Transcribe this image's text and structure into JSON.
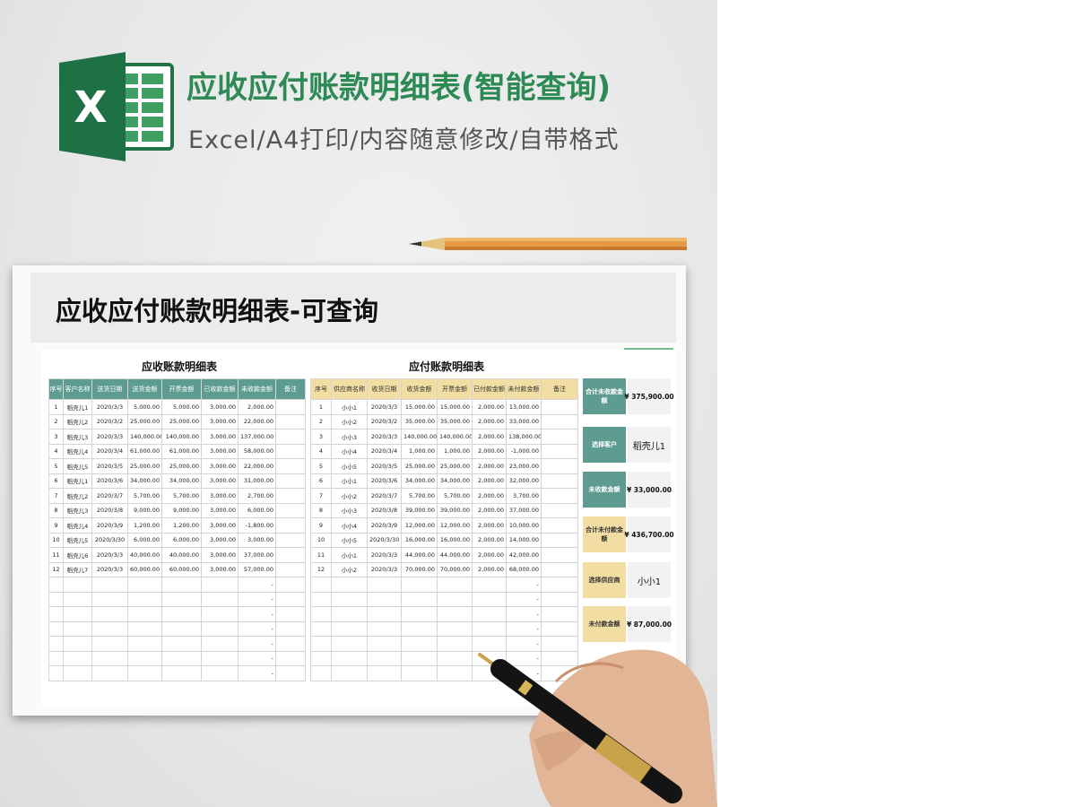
{
  "banner": {
    "logo_letter": "X",
    "title": "应收应付账款明细表(智能查询)",
    "subtitle": "Excel/A4打印/内容随意修改/自带格式",
    "colors": {
      "green": "#2e8a55",
      "subtitle": "#555555"
    },
    "icons": [
      "excel-logo-icon",
      "pencil-icon",
      "hand-with-pen-icon"
    ]
  },
  "sheet": {
    "title": "应收应付账款明细表-可查询",
    "receivable": {
      "title": "应收账款明细表",
      "header_color": "#5e9c91",
      "columns": [
        "序号",
        "客户名称",
        "送货日期",
        "送货金额",
        "开票金额",
        "已收款金额",
        "未收款金额",
        "备注"
      ],
      "rows": [
        [
          "1",
          "稻壳儿1",
          "2020/3/3",
          "5,000.00",
          "5,000.00",
          "3,000.00",
          "2,000.00",
          ""
        ],
        [
          "2",
          "稻壳儿2",
          "2020/3/2",
          "25,000.00",
          "25,000.00",
          "3,000.00",
          "22,000.00",
          ""
        ],
        [
          "3",
          "稻壳儿3",
          "2020/3/3",
          "140,000.00",
          "140,000.00",
          "3,000.00",
          "137,000.00",
          ""
        ],
        [
          "4",
          "稻壳儿4",
          "2020/3/4",
          "61,000.00",
          "61,000.00",
          "3,000.00",
          "58,000.00",
          ""
        ],
        [
          "5",
          "稻壳儿5",
          "2020/3/5",
          "25,000.00",
          "25,000.00",
          "3,000.00",
          "22,000.00",
          ""
        ],
        [
          "6",
          "稻壳儿1",
          "2020/3/6",
          "34,000.00",
          "34,000.00",
          "3,000.00",
          "31,000.00",
          ""
        ],
        [
          "7",
          "稻壳儿2",
          "2020/3/7",
          "5,700.00",
          "5,700.00",
          "3,000.00",
          "2,700.00",
          ""
        ],
        [
          "8",
          "稻壳儿3",
          "2020/3/8",
          "9,000.00",
          "9,000.00",
          "3,000.00",
          "6,000.00",
          ""
        ],
        [
          "9",
          "稻壳儿4",
          "2020/3/9",
          "1,200.00",
          "1,200.00",
          "3,000.00",
          "-1,800.00",
          ""
        ],
        [
          "10",
          "稻壳儿5",
          "2020/3/30",
          "6,000.00",
          "6,000.00",
          "3,000.00",
          "3,000.00",
          ""
        ],
        [
          "11",
          "稻壳儿6",
          "2020/3/3",
          "40,000.00",
          "40,000.00",
          "3,000.00",
          "37,000.00",
          ""
        ],
        [
          "12",
          "稻壳儿7",
          "2020/3/3",
          "60,000.00",
          "60,000.00",
          "3,000.00",
          "57,000.00",
          ""
        ],
        [
          "",
          "",
          "",
          "",
          "",
          "",
          "-",
          ""
        ],
        [
          "",
          "",
          "",
          "",
          "",
          "",
          "-",
          ""
        ],
        [
          "",
          "",
          "",
          "",
          "",
          "",
          "-",
          ""
        ],
        [
          "",
          "",
          "",
          "",
          "",
          "",
          "-",
          ""
        ],
        [
          "",
          "",
          "",
          "",
          "",
          "",
          "-",
          ""
        ],
        [
          "",
          "",
          "",
          "",
          "",
          "",
          "-",
          ""
        ],
        [
          "",
          "",
          "",
          "",
          "",
          "",
          "-",
          ""
        ]
      ]
    },
    "payable": {
      "title": "应付账款明细表",
      "header_color": "#f2dea2",
      "columns": [
        "序号",
        "供应商名称",
        "收货日期",
        "收货金额",
        "开票金额",
        "已付款金额",
        "未付款金额",
        "备注"
      ],
      "rows": [
        [
          "1",
          "小小1",
          "2020/3/3",
          "15,000.00",
          "15,000.00",
          "2,000.00",
          "13,000.00",
          ""
        ],
        [
          "2",
          "小小2",
          "2020/3/2",
          "35,000.00",
          "35,000.00",
          "2,000.00",
          "33,000.00",
          ""
        ],
        [
          "3",
          "小小3",
          "2020/3/3",
          "140,000.00",
          "140,000.00",
          "2,000.00",
          "138,000.00",
          ""
        ],
        [
          "4",
          "小小4",
          "2020/3/4",
          "1,000.00",
          "1,000.00",
          "2,000.00",
          "-1,000.00",
          ""
        ],
        [
          "5",
          "小小5",
          "2020/3/5",
          "25,000.00",
          "25,000.00",
          "2,000.00",
          "23,000.00",
          ""
        ],
        [
          "6",
          "小小1",
          "2020/3/6",
          "34,000.00",
          "34,000.00",
          "2,000.00",
          "32,000.00",
          ""
        ],
        [
          "7",
          "小小2",
          "2020/3/7",
          "5,700.00",
          "5,700.00",
          "2,000.00",
          "3,700.00",
          ""
        ],
        [
          "8",
          "小小3",
          "2020/3/8",
          "39,000.00",
          "39,000.00",
          "2,000.00",
          "37,000.00",
          ""
        ],
        [
          "9",
          "小小4",
          "2020/3/9",
          "12,000.00",
          "12,000.00",
          "2,000.00",
          "10,000.00",
          ""
        ],
        [
          "10",
          "小小5",
          "2020/3/30",
          "16,000.00",
          "16,000.00",
          "2,000.00",
          "14,000.00",
          ""
        ],
        [
          "11",
          "小小1",
          "2020/3/3",
          "44,000.00",
          "44,000.00",
          "2,000.00",
          "42,000.00",
          ""
        ],
        [
          "12",
          "小小2",
          "2020/3/3",
          "70,000.00",
          "70,000.00",
          "2,000.00",
          "68,000.00",
          ""
        ],
        [
          "",
          "",
          "",
          "",
          "",
          "",
          "-",
          ""
        ],
        [
          "",
          "",
          "",
          "",
          "",
          "",
          "-",
          ""
        ],
        [
          "",
          "",
          "",
          "",
          "",
          "",
          "-",
          ""
        ],
        [
          "",
          "",
          "",
          "",
          "",
          "",
          "-",
          ""
        ],
        [
          "",
          "",
          "",
          "",
          "",
          "",
          "-",
          ""
        ],
        [
          "",
          "",
          "",
          "",
          "",
          "",
          "-",
          ""
        ],
        [
          "",
          "",
          "",
          "",
          "",
          "",
          "-",
          ""
        ]
      ]
    },
    "summary": {
      "total_unreceived": {
        "label": "合计未收款金额",
        "value": "¥    375,900.00"
      },
      "select_customer": {
        "label": "选择客户",
        "value": "稻壳儿1"
      },
      "unreceived": {
        "label": "未收款金额",
        "value": "¥      33,000.00"
      },
      "total_unpaid": {
        "label": "合计未付款金额",
        "value": "¥    436,700.00"
      },
      "select_supplier": {
        "label": "选择供应商",
        "value": "小小1"
      },
      "unpaid": {
        "label": "未付款金额",
        "value": "¥      87,000.00"
      }
    }
  }
}
